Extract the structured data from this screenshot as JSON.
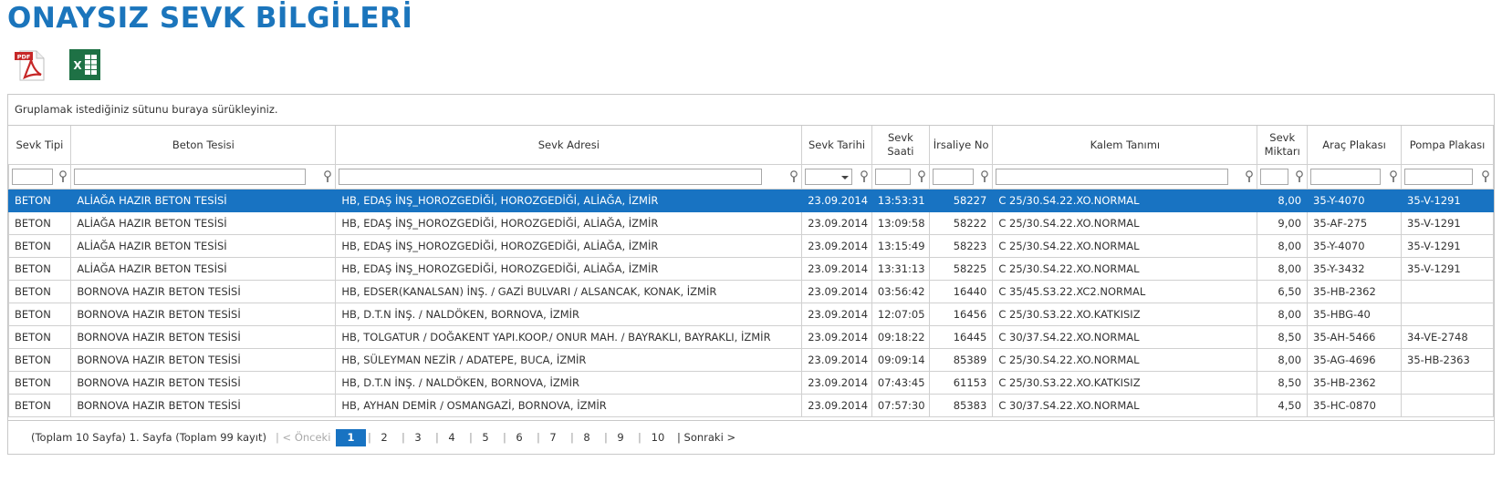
{
  "page": {
    "title": "ONAYSIZ SEVK BİLGİLERİ"
  },
  "toolbar": {
    "pdf_label": "PDF",
    "excel_label": "X"
  },
  "grid": {
    "group_hint": "Gruplamak istediğiniz sütunu buraya sürükleyiniz.",
    "columns": [
      {
        "key": "tip",
        "label": "Sevk Tipi"
      },
      {
        "key": "tesis",
        "label": "Beton Tesisi"
      },
      {
        "key": "adres",
        "label": "Sevk Adresi"
      },
      {
        "key": "tarih",
        "label": "Sevk Tarihi"
      },
      {
        "key": "saat",
        "label": "Sevk Saati"
      },
      {
        "key": "irsaliye",
        "label": "İrsaliye No"
      },
      {
        "key": "kalem",
        "label": "Kalem Tanımı"
      },
      {
        "key": "miktar",
        "label": "Sevk Miktarı"
      },
      {
        "key": "arac",
        "label": "Araç Plakası"
      },
      {
        "key": "pompa",
        "label": "Pompa Plakası"
      }
    ],
    "selected_row": 0,
    "rows": [
      [
        "BETON",
        "ALİAĞA HAZIR BETON TESİSİ",
        "HB, EDAŞ İNŞ_HOROZGEDİĞİ, HOROZGEDİĞİ, ALİAĞA, İZMİR",
        "23.09.2014",
        "13:53:31",
        "58227",
        "C 25/30.S4.22.XO.NORMAL",
        "8,00",
        "35-Y-4070",
        "35-V-1291"
      ],
      [
        "BETON",
        "ALİAĞA HAZIR BETON TESİSİ",
        "HB, EDAŞ İNŞ_HOROZGEDİĞİ, HOROZGEDİĞİ, ALİAĞA, İZMİR",
        "23.09.2014",
        "13:09:58",
        "58222",
        "C 25/30.S4.22.XO.NORMAL",
        "9,00",
        "35-AF-275",
        "35-V-1291"
      ],
      [
        "BETON",
        "ALİAĞA HAZIR BETON TESİSİ",
        "HB, EDAŞ İNŞ_HOROZGEDİĞİ, HOROZGEDİĞİ, ALİAĞA, İZMİR",
        "23.09.2014",
        "13:15:49",
        "58223",
        "C 25/30.S4.22.XO.NORMAL",
        "8,00",
        "35-Y-4070",
        "35-V-1291"
      ],
      [
        "BETON",
        "ALİAĞA HAZIR BETON TESİSİ",
        "HB, EDAŞ İNŞ_HOROZGEDİĞİ, HOROZGEDİĞİ, ALİAĞA, İZMİR",
        "23.09.2014",
        "13:31:13",
        "58225",
        "C 25/30.S4.22.XO.NORMAL",
        "8,00",
        "35-Y-3432",
        "35-V-1291"
      ],
      [
        "BETON",
        "BORNOVA HAZIR BETON TESİSİ",
        "HB, EDSER(KANALSAN) İNŞ. / GAZİ BULVARI / ALSANCAK, KONAK, İZMİR",
        "23.09.2014",
        "03:56:42",
        "16440",
        "C 35/45.S3.22.XC2.NORMAL",
        "6,50",
        "35-HB-2362",
        ""
      ],
      [
        "BETON",
        "BORNOVA HAZIR BETON TESİSİ",
        "HB, D.T.N İNŞ. / NALDÖKEN, BORNOVA, İZMİR",
        "23.09.2014",
        "12:07:05",
        "16456",
        "C 25/30.S3.22.XO.KATKISIZ",
        "8,00",
        "35-HBG-40",
        ""
      ],
      [
        "BETON",
        "BORNOVA HAZIR BETON TESİSİ",
        "HB, TOLGATUR / DOĞAKENT YAPI.KOOP./ ONUR MAH. / BAYRAKLI, BAYRAKLI, İZMİR",
        "23.09.2014",
        "09:18:22",
        "16445",
        "C 30/37.S4.22.XO.NORMAL",
        "8,50",
        "35-AH-5466",
        "34-VE-2748"
      ],
      [
        "BETON",
        "BORNOVA HAZIR BETON TESİSİ",
        "HB, SÜLEYMAN NEZİR / ADATEPE, BUCA, İZMİR",
        "23.09.2014",
        "09:09:14",
        "85389",
        "C 25/30.S4.22.XO.NORMAL",
        "8,00",
        "35-AG-4696",
        "35-HB-2363"
      ],
      [
        "BETON",
        "BORNOVA HAZIR BETON TESİSİ",
        "HB, D.T.N İNŞ. / NALDÖKEN, BORNOVA, İZMİR",
        "23.09.2014",
        "07:43:45",
        "61153",
        "C 25/30.S3.22.XO.KATKISIZ",
        "8,50",
        "35-HB-2362",
        ""
      ],
      [
        "BETON",
        "BORNOVA HAZIR BETON TESİSİ",
        "HB, AYHAN DEMİR / OSMANGAZİ, BORNOVA, İZMİR",
        "23.09.2014",
        "07:57:30",
        "85383",
        "C 30/37.S4.22.XO.NORMAL",
        "4,50",
        "35-HC-0870",
        ""
      ]
    ]
  },
  "pager": {
    "summary": "(Toplam 10 Sayfa) 1. Sayfa (Toplam 99 kayıt)",
    "prev_label": "| < Önceki",
    "next_label": "| Sonraki >",
    "pages": [
      "1",
      "2",
      "3",
      "4",
      "5",
      "6",
      "7",
      "8",
      "9",
      "10"
    ],
    "current_page": "1"
  },
  "colors": {
    "title": "#1b75bc",
    "selection": "#1873c2",
    "border": "#d0d0d0"
  }
}
